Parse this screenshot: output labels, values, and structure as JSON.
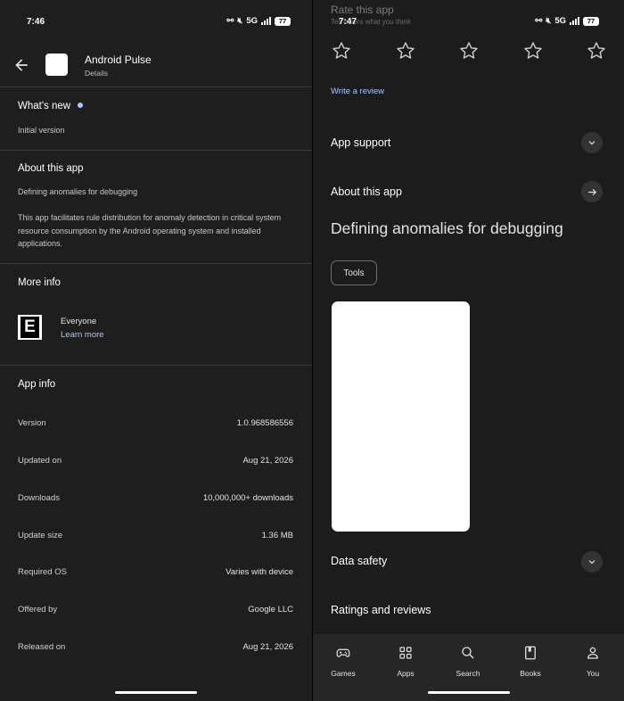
{
  "left": {
    "status": {
      "time": "7:46",
      "network": "5G",
      "battery": "77"
    },
    "header": {
      "app_name": "Android Pulse",
      "subtitle": "Details"
    },
    "whats_new": {
      "title": "What's new",
      "text": "Initial version"
    },
    "about": {
      "title": "About this app",
      "tagline": "Defining anomalies for debugging",
      "description": "This app facilitates rule distribution for anomaly detection in critical system resource consumption by the Android operating system and installed applications."
    },
    "more_info": {
      "title": "More info",
      "rating_letter": "E",
      "rating_name": "Everyone",
      "learn_more": "Learn more"
    },
    "app_info": {
      "title": "App info",
      "rows": [
        {
          "label": "Version",
          "value": "1.0.968586556"
        },
        {
          "label": "Updated on",
          "value": "Aug 21, 2026"
        },
        {
          "label": "Downloads",
          "value": "10,000,000+ downloads"
        },
        {
          "label": "Update size",
          "value": "1.36 MB"
        },
        {
          "label": "Required OS",
          "value": "Varies with device"
        },
        {
          "label": "Offered by",
          "value": "Google LLC"
        },
        {
          "label": "Released on",
          "value": "Aug 21, 2026"
        }
      ]
    }
  },
  "right": {
    "status": {
      "time": "7:47",
      "network": "5G",
      "battery": "77"
    },
    "rate": {
      "title": "Rate this app",
      "subtitle": "Tell others what you think"
    },
    "write_review": "Write a review",
    "app_support": "App support",
    "about_title": "About this app",
    "tagline": "Defining anomalies for debugging",
    "chip": "Tools",
    "data_safety": "Data safety",
    "ratings_reviews": "Ratings and reviews",
    "nav": [
      {
        "label": "Games",
        "icon": "gamepad-icon"
      },
      {
        "label": "Apps",
        "icon": "apps-grid-icon"
      },
      {
        "label": "Search",
        "icon": "search-icon"
      },
      {
        "label": "Books",
        "icon": "book-icon"
      },
      {
        "label": "You",
        "icon": "person-icon"
      }
    ]
  }
}
